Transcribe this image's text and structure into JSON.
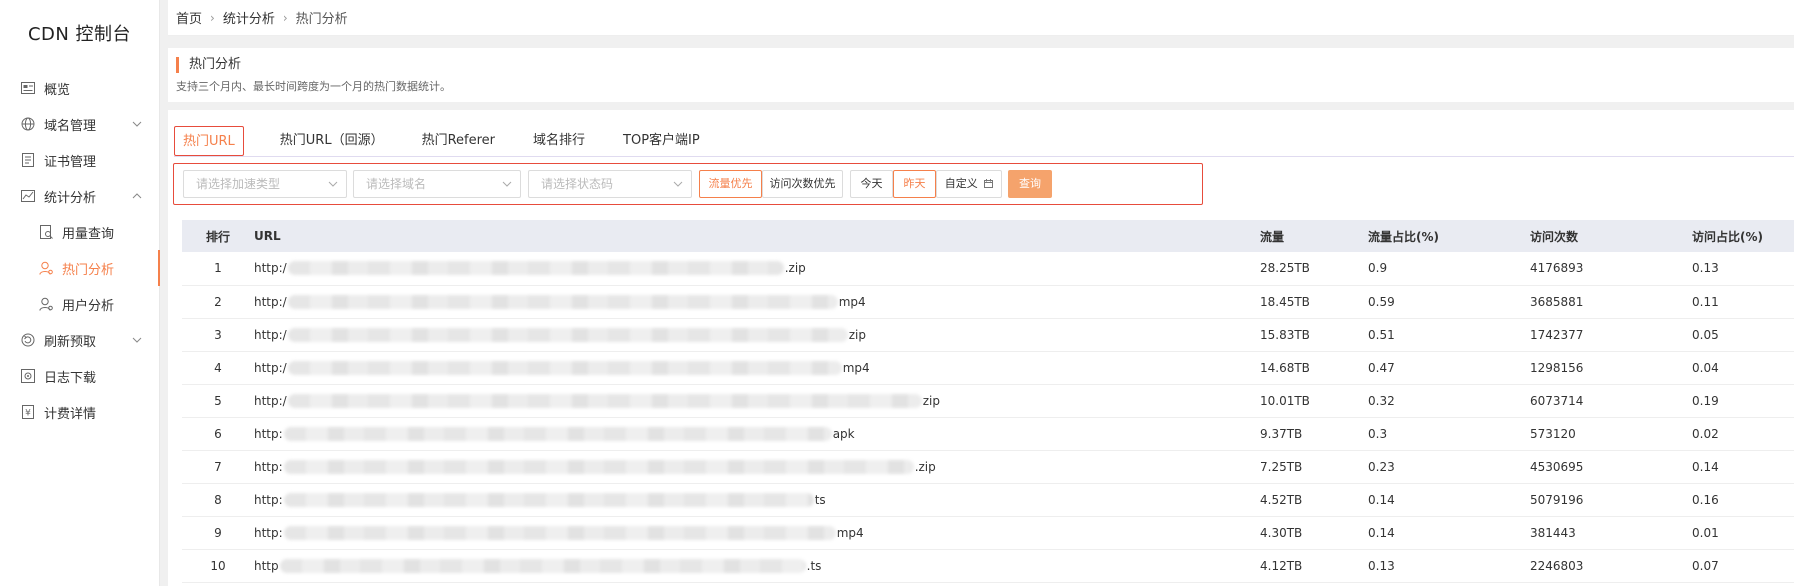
{
  "sidebar": {
    "brand": "CDN 控制台",
    "items": [
      {
        "label": "概览",
        "icon": "overview-icon"
      },
      {
        "label": "域名管理",
        "icon": "domain-icon"
      },
      {
        "label": "证书管理",
        "icon": "certificate-icon"
      },
      {
        "label": "统计分析",
        "icon": "statistics-icon"
      },
      {
        "label": "用量查询",
        "icon": "usage-icon"
      },
      {
        "label": "热门分析",
        "icon": "user-hot-icon"
      },
      {
        "label": "用户分析",
        "icon": "user-analysis-icon"
      },
      {
        "label": "刷新预取",
        "icon": "refresh-icon"
      },
      {
        "label": "日志下载",
        "icon": "log-icon"
      },
      {
        "label": "计费详情",
        "icon": "billing-icon"
      }
    ]
  },
  "breadcrumb": {
    "home": "首页",
    "section": "统计分析",
    "current": "热门分析"
  },
  "header": {
    "title": "热门分析",
    "description": "支持三个月内、最长时间跨度为一个月的热门数据统计。"
  },
  "tabs": [
    {
      "label": "热门URL",
      "active": true
    },
    {
      "label": "热门URL（回源）",
      "active": false
    },
    {
      "label": "热门Referer",
      "active": false
    },
    {
      "label": "域名排行",
      "active": false
    },
    {
      "label": "TOP客户端IP",
      "active": false
    }
  ],
  "filters": {
    "accel_type_placeholder": "请选择加速类型",
    "domain_placeholder": "请选择域名",
    "status_placeholder": "请选择状态码",
    "sort_flow": "流量优先",
    "sort_visits": "访问次数优先",
    "today": "今天",
    "yesterday": "昨天",
    "custom": "自定义",
    "query": "查询"
  },
  "table": {
    "headers": {
      "rank": "排行",
      "url": "URL",
      "flow": "流量",
      "flow_ratio": "流量占比(%)",
      "visits": "访问次数",
      "visit_ratio": "访问占比(%)"
    },
    "rows": [
      {
        "rank": "1",
        "prefix": "http:/",
        "suffix": ".zip",
        "flow": "28.25TB",
        "flow_ratio": "0.9",
        "visits": "4176893",
        "visit_ratio": "0.13"
      },
      {
        "rank": "2",
        "prefix": "http:/",
        "suffix": "mp4",
        "flow": "18.45TB",
        "flow_ratio": "0.59",
        "visits": "3685881",
        "visit_ratio": "0.11"
      },
      {
        "rank": "3",
        "prefix": "http:/",
        "suffix": "zip",
        "flow": "15.83TB",
        "flow_ratio": "0.51",
        "visits": "1742377",
        "visit_ratio": "0.05"
      },
      {
        "rank": "4",
        "prefix": "http:/",
        "suffix": "mp4",
        "flow": "14.68TB",
        "flow_ratio": "0.47",
        "visits": "1298156",
        "visit_ratio": "0.04"
      },
      {
        "rank": "5",
        "prefix": "http:/",
        "suffix": "zip",
        "flow": "10.01TB",
        "flow_ratio": "0.32",
        "visits": "6073714",
        "visit_ratio": "0.19"
      },
      {
        "rank": "6",
        "prefix": "http:",
        "suffix": "apk",
        "flow": "9.37TB",
        "flow_ratio": "0.3",
        "visits": "573120",
        "visit_ratio": "0.02"
      },
      {
        "rank": "7",
        "prefix": "http:",
        "suffix": ".zip",
        "flow": "7.25TB",
        "flow_ratio": "0.23",
        "visits": "4530695",
        "visit_ratio": "0.14"
      },
      {
        "rank": "8",
        "prefix": "http:",
        "suffix": "ts",
        "flow": "4.52TB",
        "flow_ratio": "0.14",
        "visits": "5079196",
        "visit_ratio": "0.16"
      },
      {
        "rank": "9",
        "prefix": "http:",
        "suffix": "mp4",
        "flow": "4.30TB",
        "flow_ratio": "0.14",
        "visits": "381443",
        "visit_ratio": "0.01"
      },
      {
        "rank": "10",
        "prefix": "http",
        "suffix": ".ts",
        "flow": "4.12TB",
        "flow_ratio": "0.13",
        "visits": "2246803",
        "visit_ratio": "0.07"
      }
    ]
  },
  "colors": {
    "accent": "#f5804b",
    "highlight_border": "#e74c3c",
    "table_header_bg": "#e9ebf2"
  }
}
